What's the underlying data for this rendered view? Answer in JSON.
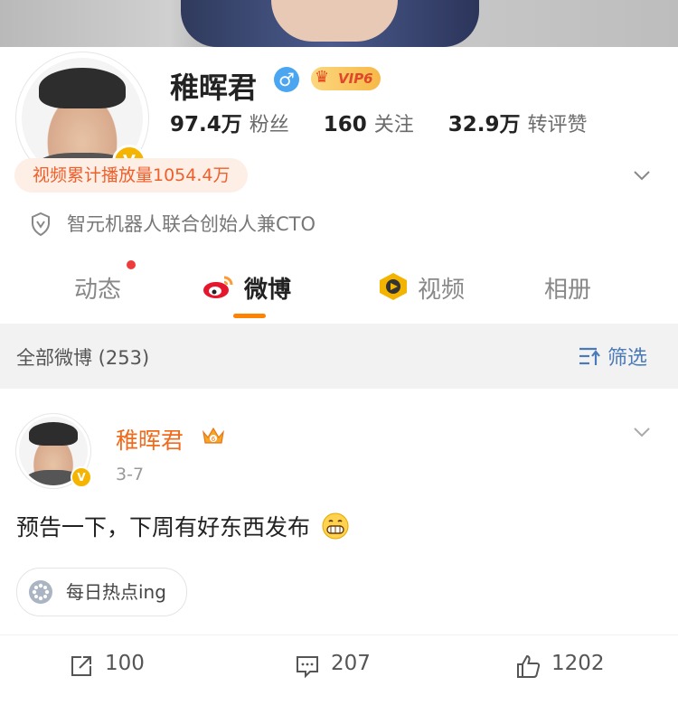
{
  "profile": {
    "name": "稚晖君",
    "vip_label": "VIP6",
    "stats": [
      {
        "value": "97.4万",
        "label": "粉丝"
      },
      {
        "value": "160",
        "label": "关注"
      },
      {
        "value": "32.9万",
        "label": "转评赞"
      }
    ],
    "views_tag": "视频累计播放量1054.4万",
    "verification": "智元机器人联合创始人兼CTO"
  },
  "tabs": [
    {
      "label": "动态",
      "has_dot": true
    },
    {
      "label": "微博",
      "active": true
    },
    {
      "label": "视频"
    },
    {
      "label": "相册"
    }
  ],
  "filter_bar": {
    "all_label": "全部微博 (253)",
    "filter_label": "筛选"
  },
  "post": {
    "author": "稚晖君",
    "date": "3-7",
    "text": "预告一下，下周有好东西发布",
    "topic": "每日热点ing",
    "reposts": "100",
    "comments": "207",
    "likes": "1202"
  },
  "colors": {
    "accent_orange": "#ff8200",
    "author_orange": "#f26a1b",
    "link_blue": "#4a7ab8",
    "verified_gold": "#f5b400"
  },
  "icons": [
    "male-icon",
    "vip-crown-icon",
    "verified-v-icon",
    "chevron-down-icon",
    "shield-icon",
    "weibo-logo-icon",
    "video-logo-icon",
    "filter-icon",
    "topic-icon",
    "repost-icon",
    "comment-icon",
    "like-icon",
    "grin-emoji-icon"
  ]
}
